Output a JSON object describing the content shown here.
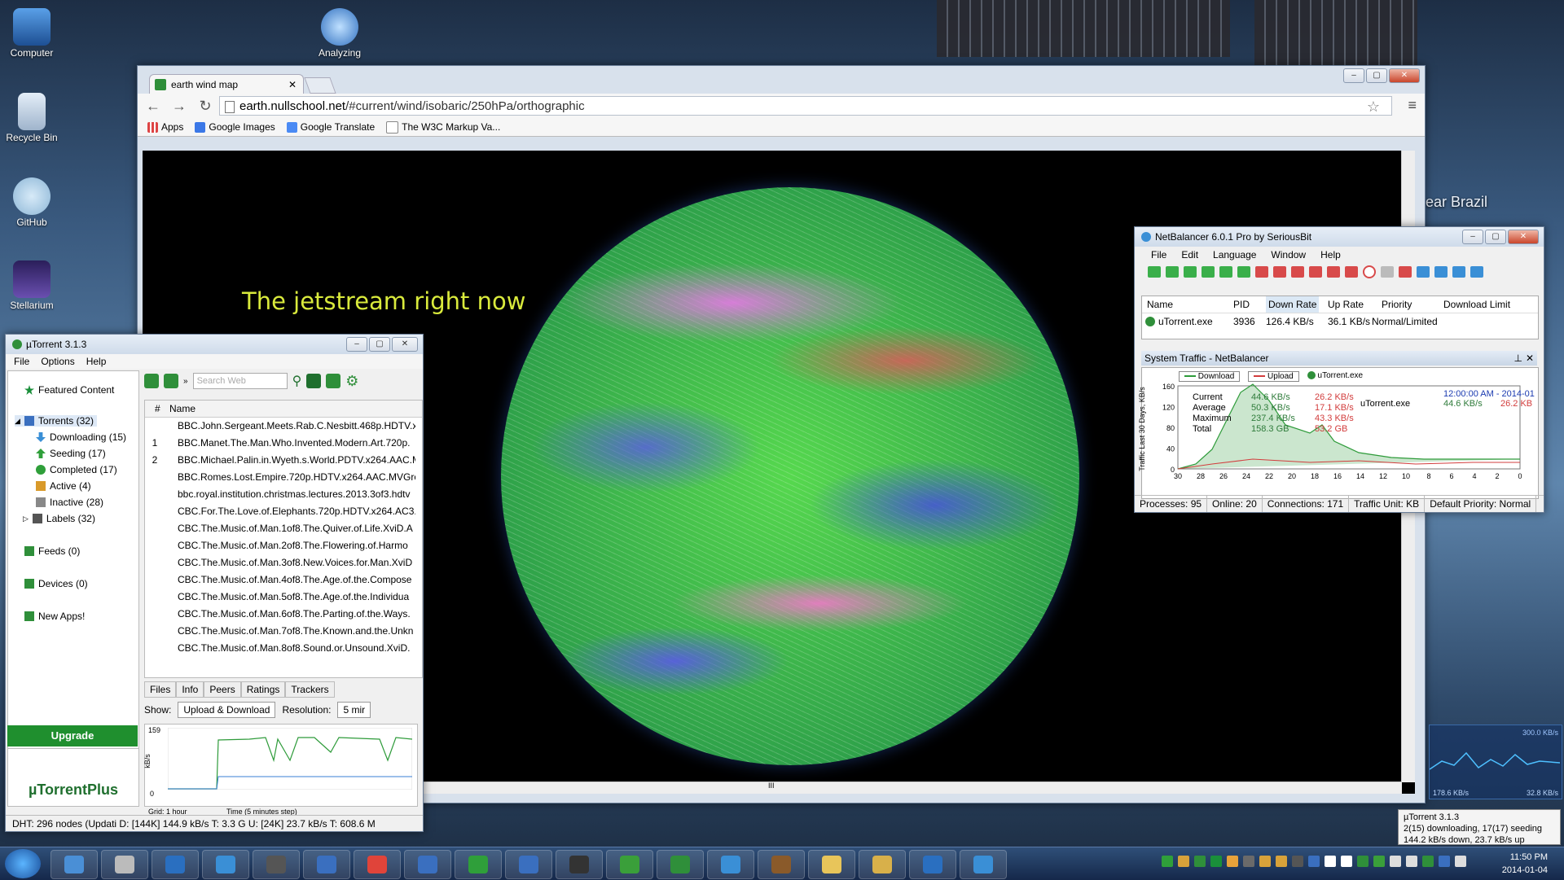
{
  "desktop_icons": [
    "Computer",
    "Analyzing",
    "Recycle Bin",
    "GitHub",
    "Stellarium"
  ],
  "background_text": "ear Brazil",
  "browser": {
    "tab_title": "earth wind map",
    "url_host": "earth.nullschool.net",
    "url_path": "/#current/wind/isobaric/250hPa/orthographic",
    "bookmarks": [
      "Apps",
      "Google Images",
      "Google Translate",
      "The W3C Markup Va..."
    ],
    "page_heading": "The jetstream right now",
    "scroll_mark": "III"
  },
  "utorrent": {
    "title": "µTorrent 3.1.3",
    "menu": [
      "File",
      "Options",
      "Help"
    ],
    "sidebar": {
      "featured": "Featured Content",
      "torrents": "Torrents (32)",
      "downloading": "Downloading (15)",
      "seeding": "Seeding (17)",
      "completed": "Completed (17)",
      "active": "Active (4)",
      "inactive": "Inactive (28)",
      "labels": "Labels (32)",
      "feeds": "Feeds (0)",
      "devices": "Devices (0)",
      "newapps": "New Apps!"
    },
    "search_placeholder": "Search Web",
    "col_num": "#",
    "col_name": "Name",
    "rows": [
      {
        "n": "",
        "name": "BBC.John.Sergeant.Meets.Rab.C.Nesbitt.468p.HDTV.x2"
      },
      {
        "n": "1",
        "name": "BBC.Manet.The.Man.Who.Invented.Modern.Art.720p."
      },
      {
        "n": "2",
        "name": "BBC.Michael.Palin.in.Wyeth.s.World.PDTV.x264.AAC.M"
      },
      {
        "n": "",
        "name": "BBC.Romes.Lost.Empire.720p.HDTV.x264.AAC.MVGro"
      },
      {
        "n": "",
        "name": "bbc.royal.institution.christmas.lectures.2013.3of3.hdtv"
      },
      {
        "n": "",
        "name": "CBC.For.The.Love.of.Elephants.720p.HDTV.x264.AC3.N"
      },
      {
        "n": "",
        "name": "CBC.The.Music.of.Man.1of8.The.Quiver.of.Life.XviD.A"
      },
      {
        "n": "",
        "name": "CBC.The.Music.of.Man.2of8.The.Flowering.of.Harmo"
      },
      {
        "n": "",
        "name": "CBC.The.Music.of.Man.3of8.New.Voices.for.Man.XviD"
      },
      {
        "n": "",
        "name": "CBC.The.Music.of.Man.4of8.The.Age.of.the.Compose"
      },
      {
        "n": "",
        "name": "CBC.The.Music.of.Man.5of8.The.Age.of.the.Individua"
      },
      {
        "n": "",
        "name": "CBC.The.Music.of.Man.6of8.The.Parting.of.the.Ways."
      },
      {
        "n": "",
        "name": "CBC.The.Music.of.Man.7of8.The.Known.and.the.Unkn"
      },
      {
        "n": "",
        "name": "CBC.The.Music.of.Man.8of8.Sound.or.Unsound.XviD."
      }
    ],
    "detail_tabs": [
      "Files",
      "Info",
      "Peers",
      "Ratings",
      "Trackers"
    ],
    "show_label": "Show:",
    "show_value": "Upload & Download",
    "resolution_label": "Resolution:",
    "resolution_value": "5 mir",
    "graph_ymax": "159",
    "graph_ylabel": "kB/s",
    "graph_yzero": "0",
    "graph_grid": "Grid: 1 hour",
    "graph_time": "Time (5 minutes step)",
    "upgrade": "Upgrade",
    "plus_logo": "µTorrentPlus",
    "status": "DHT: 296 nodes (Updati  D:  [144K] 144.9 kB/s T: 3.3 G  U:  [24K] 23.7 kB/s T: 608.6 M"
  },
  "netbalancer": {
    "title": "NetBalancer 6.0.1 Pro by SeriousBit",
    "menu": [
      "File",
      "Edit",
      "Language",
      "Window",
      "Help"
    ],
    "headers": [
      "Name",
      "PID",
      "Down Rate",
      "Up Rate",
      "Priority",
      "Download Limit"
    ],
    "row": {
      "name": "uTorrent.exe",
      "pid": "3936",
      "down": "126.4 KB/s",
      "up": "36.1 KB/s",
      "priority": "Normal/Limited"
    },
    "system_traffic": "System Traffic - NetBalancer",
    "legend": [
      "Download",
      "Upload",
      "uTorrent.exe"
    ],
    "y_axis_label": "Traffic Last 30 Days, KB/s",
    "y_ticks": [
      "160",
      "120",
      "80",
      "40",
      "0"
    ],
    "x_ticks": [
      "30",
      "28",
      "26",
      "24",
      "22",
      "20",
      "18",
      "16",
      "14",
      "12",
      "10",
      "8",
      "6",
      "4",
      "2",
      "0"
    ],
    "stats": [
      {
        "label": "Current",
        "down": "44.6 KB/s",
        "up": "26.2 KB/s"
      },
      {
        "label": "Average",
        "down": "50.3 KB/s",
        "up": "17.1 KB/s"
      },
      {
        "label": "Maximum",
        "down": "237.4 KB/s",
        "up": "43.3 KB/s"
      },
      {
        "label": "Total",
        "down": "158.3 GB",
        "up": "53.2 GB"
      }
    ],
    "side_app": "uTorrent.exe",
    "side_time": "12:00:00 AM - 2014-01",
    "side_down": "44.6 KB/s",
    "side_up": "26.2 KB",
    "status": [
      "Processes: 95",
      "Online: 20",
      "Connections: 171",
      "Traffic Unit: KB",
      "Default Priority: Normal"
    ]
  },
  "gadget": {
    "top": "300.0 KB/s",
    "left": "178.6 KB/s",
    "right": "32.8 KB/s"
  },
  "tooltip": {
    "line1": "µTorrent 3.1.3",
    "line2": "2(15) downloading, 17(17) seeding",
    "line3": "144.2 kB/s down, 23.7 kB/s up"
  },
  "clock": {
    "time": "11:50 PM",
    "date": "2014-01-04"
  },
  "colors": {
    "download": "#2e9b3a",
    "upload": "#d23c3c",
    "upgrade": "#1f8f2e",
    "jetstream_text": "#d9ea3c"
  }
}
